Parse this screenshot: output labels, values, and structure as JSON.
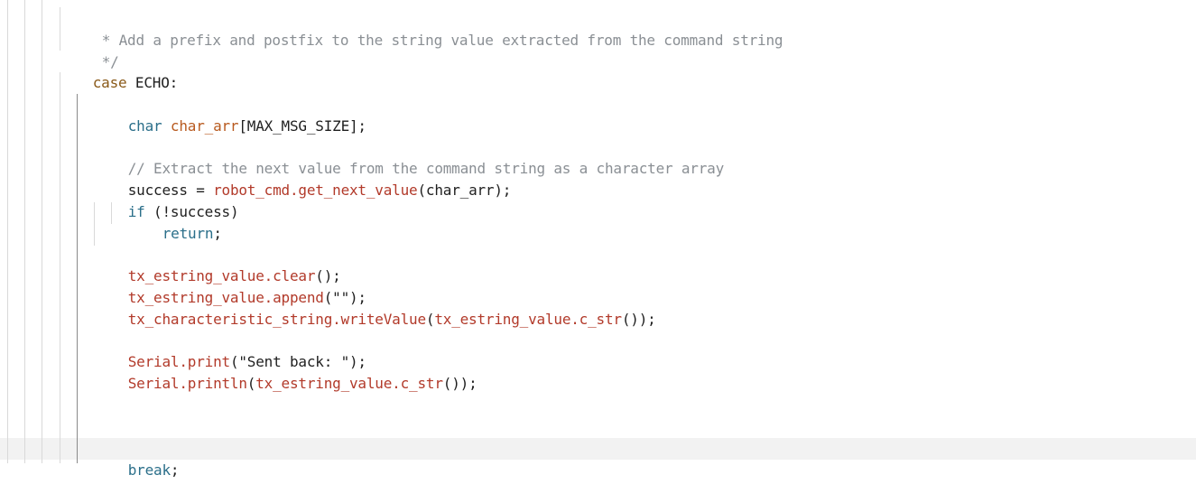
{
  "code": {
    "comment_line": "* Add a prefix and postfix to the string value extracted from the command string",
    "comment_end": "*/",
    "case_kw": "case",
    "case_label": " ECHO:",
    "decl_type": "char",
    "decl_name": "char_arr",
    "decl_rest": "[MAX_MSG_SIZE];",
    "extract_comment": "// Extract the next value from the command string as a character array",
    "success_lhs": "success = ",
    "success_call": "robot_cmd.get_next_value",
    "success_args": "(char_arr);",
    "if_kw": "if",
    "if_cond": " (!success)",
    "return_kw": "return",
    "return_end": ";",
    "clear_obj": "tx_estring_value.clear",
    "clear_end": "();",
    "append_obj": "tx_estring_value.append",
    "append_args": "(\"\");",
    "write_obj": "tx_characteristic_string.writeValue",
    "write_arg_obj": "tx_estring_value.c_str",
    "write_end": "());",
    "print_obj": "Serial.print",
    "print_args": "(\"Sent back: \");",
    "println_obj": "Serial.println",
    "println_arg_obj": "tx_estring_value.c_str",
    "println_end": "());",
    "break_kw": "break",
    "break_end": ";"
  }
}
